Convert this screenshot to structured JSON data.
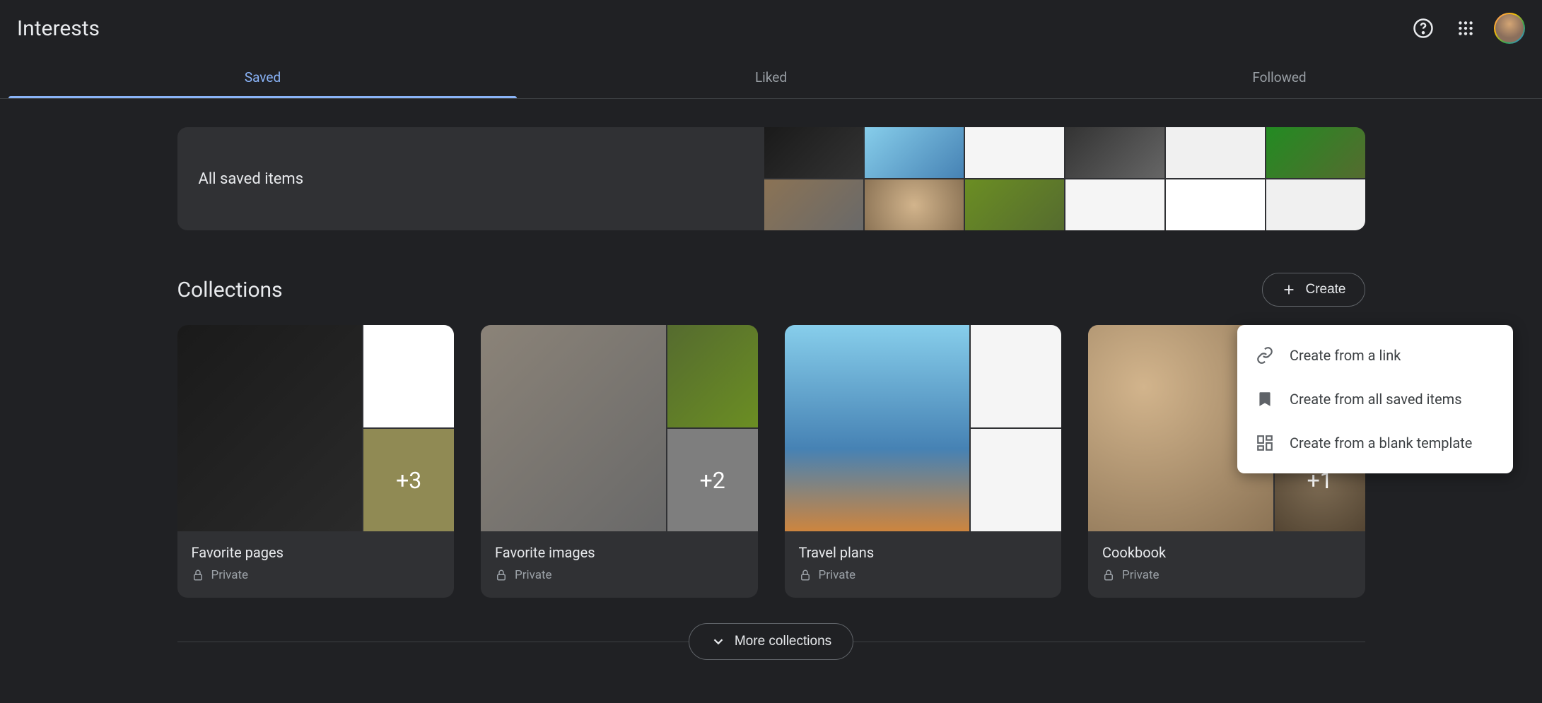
{
  "header": {
    "title": "Interests"
  },
  "tabs": [
    {
      "label": "Saved",
      "active": true
    },
    {
      "label": "Liked",
      "active": false
    },
    {
      "label": "Followed",
      "active": false
    }
  ],
  "all_saved": {
    "label": "All saved items"
  },
  "collections": {
    "title": "Collections",
    "create_label": "Create",
    "items": [
      {
        "title": "Favorite pages",
        "privacy": "Private",
        "overflow": "+3"
      },
      {
        "title": "Favorite images",
        "privacy": "Private",
        "overflow": "+2"
      },
      {
        "title": "Travel plans",
        "privacy": "Private",
        "overflow": ""
      },
      {
        "title": "Cookbook",
        "privacy": "Private",
        "overflow": "+1"
      }
    ],
    "more_label": "More collections"
  },
  "create_menu": [
    {
      "label": "Create from a link",
      "icon": "link-icon"
    },
    {
      "label": "Create from all saved items",
      "icon": "bookmark-icon"
    },
    {
      "label": "Create from a blank template",
      "icon": "dashboard-icon"
    }
  ]
}
